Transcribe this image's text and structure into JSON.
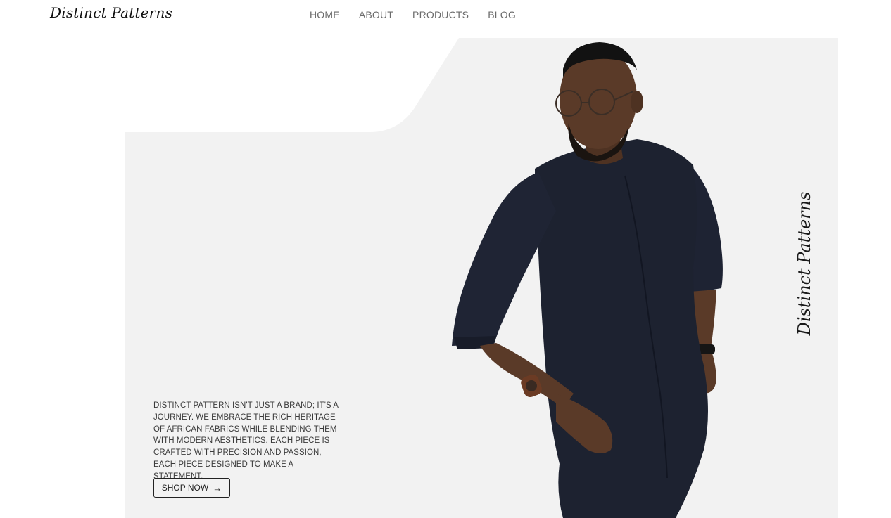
{
  "header": {
    "logo": "Distinct Patterns",
    "nav": [
      {
        "label": "HOME"
      },
      {
        "label": "ABOUT"
      },
      {
        "label": "PRODUCTS"
      },
      {
        "label": "BLOG"
      }
    ]
  },
  "hero": {
    "vertical_brand": "Distinct Patterns",
    "tagline": "DISTINCT PATTERN ISN'T JUST A BRAND; IT'S A JOURNEY. WE EMBRACE THE RICH HERITAGE OF AFRICAN FABRICS WHILE BLENDING THEM WITH MODERN AESTHETICS. EACH PIECE IS CRAFTED WITH PRECISION AND PASSION, EACH PIECE DESIGNED TO MAKE A STATEMENT.",
    "cta_label": "SHOP NOW",
    "cta_icon": "arrow-right-icon"
  },
  "colors": {
    "panel_bg": "#f2f2f2",
    "text_dark": "#1a1a1a",
    "nav_text": "#6b6b6b",
    "outfit": "#1d2230",
    "skin": "#5a3a28"
  }
}
